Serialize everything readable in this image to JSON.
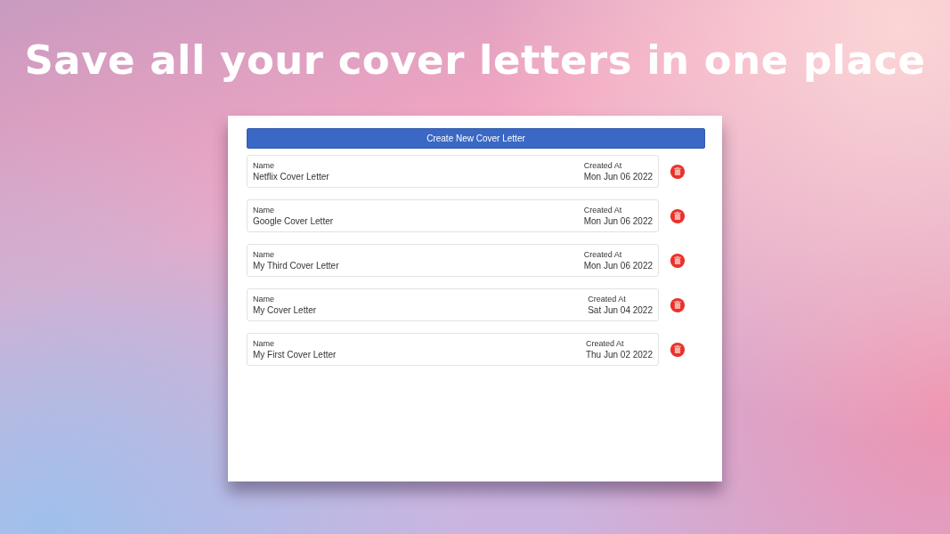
{
  "headline": "Save all your cover letters in one place",
  "create_button": "Create New Cover Letter",
  "letters": [
    {
      "name_label": "Name",
      "name": "Netflix Cover Letter",
      "created_label": "Created At",
      "created": "Mon Jun 06 2022"
    },
    {
      "name_label": "Name",
      "name": "Google Cover Letter",
      "created_label": "Created At",
      "created": "Mon Jun 06 2022"
    },
    {
      "name_label": "Name",
      "name": "My Third Cover Letter",
      "created_label": "Created At",
      "created": "Mon Jun 06 2022"
    },
    {
      "name_label": "Name",
      "name": "My Cover Letter",
      "created_label": "Created At",
      "created": "Sat Jun 04 2022"
    },
    {
      "name_label": "Name",
      "name": "My First Cover Letter",
      "created_label": "Created At",
      "created": "Thu Jun 02 2022"
    }
  ]
}
